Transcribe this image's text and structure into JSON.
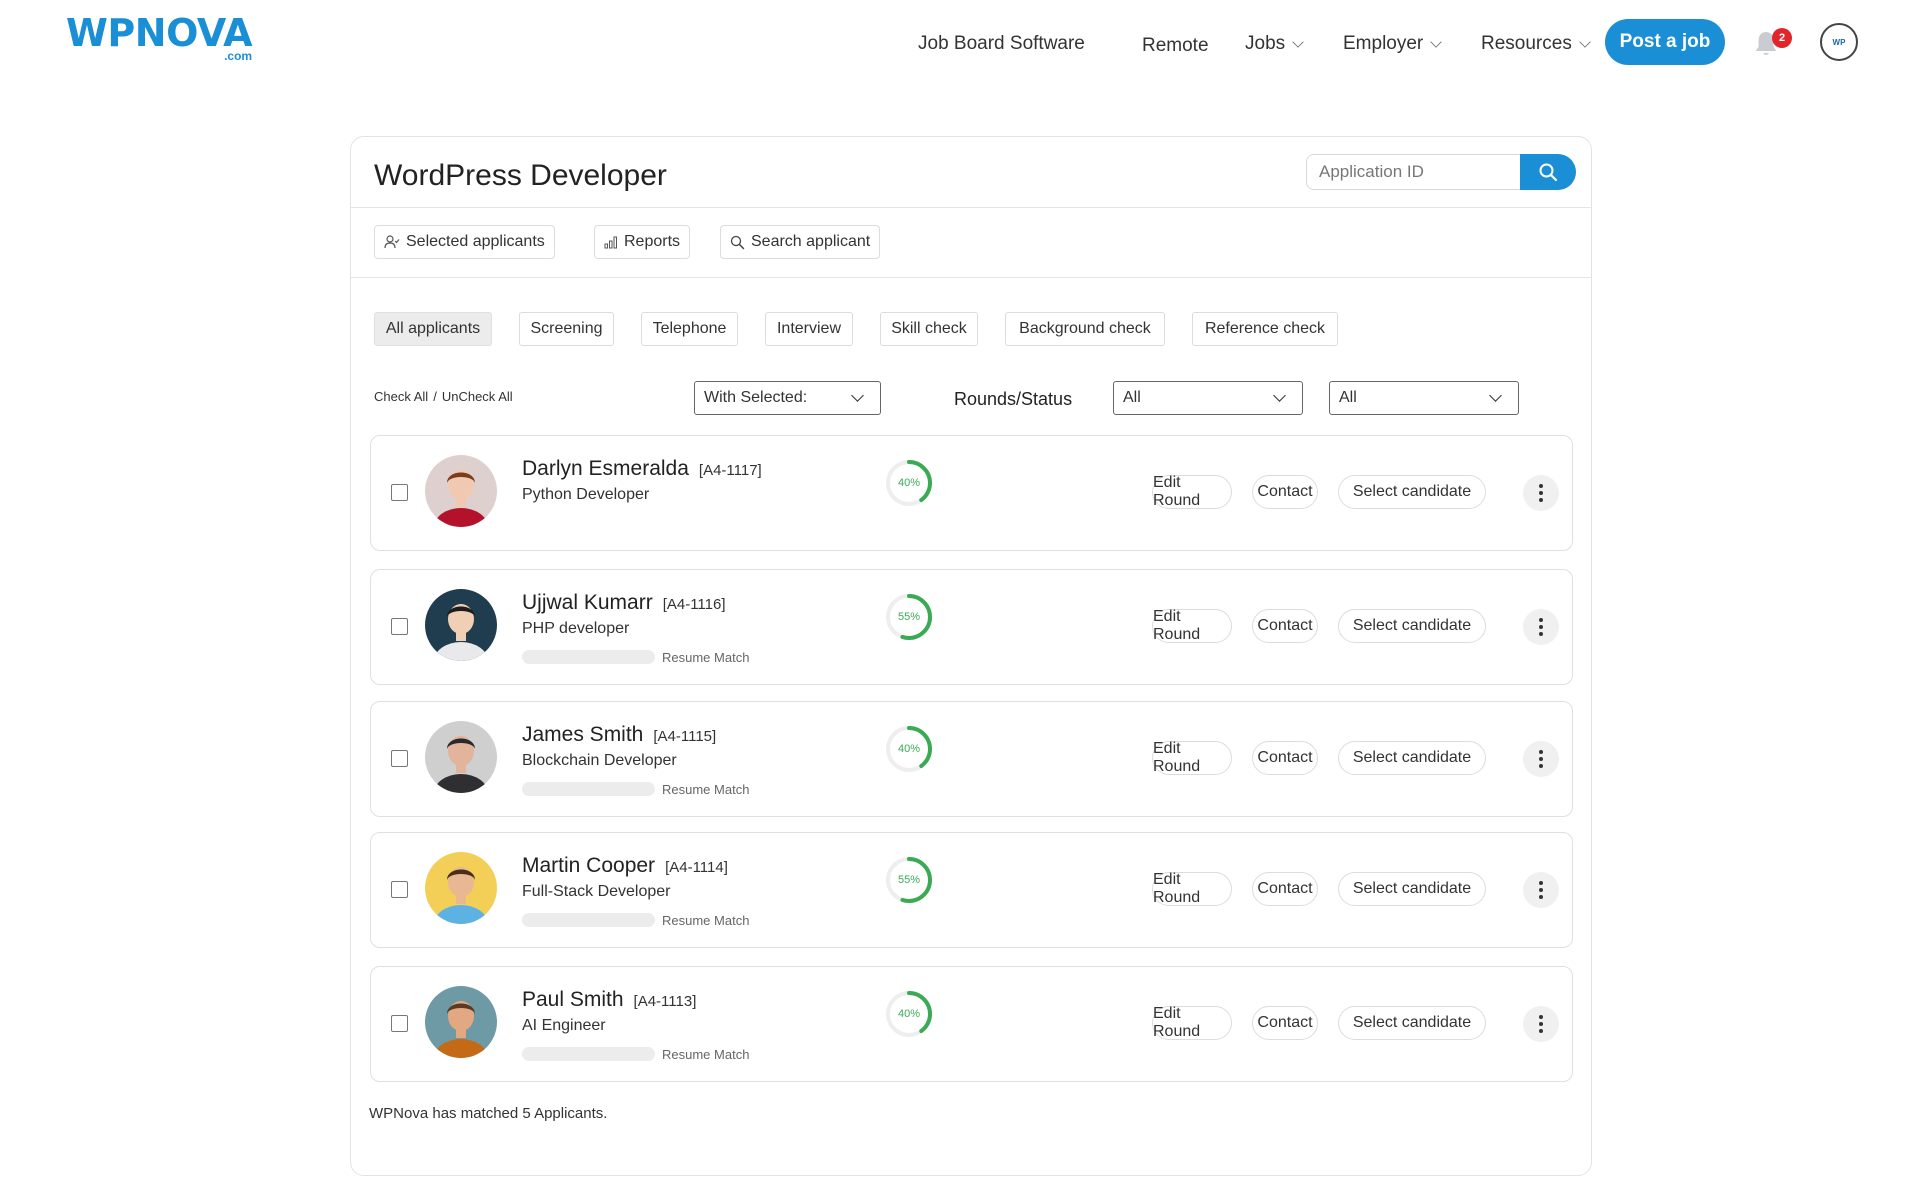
{
  "header": {
    "logo_word": "WPNOVA",
    "logo_tld": ".com",
    "nav": {
      "job_board": "Job Board Software",
      "remote": "Remote",
      "jobs": "Jobs",
      "employer": "Employer",
      "resources": "Resources"
    },
    "post_job": "Post a job",
    "notification_count": "2",
    "user_avatar_text": "WP"
  },
  "page": {
    "title": "WordPress Developer",
    "search_placeholder": "Application ID",
    "toolbar": {
      "selected": "Selected applicants",
      "reports": "Reports",
      "search": "Search applicant"
    },
    "tabs": [
      "All applicants",
      "Screening",
      "Telephone",
      "Interview",
      "Skill check",
      "Background check",
      "Reference check"
    ],
    "active_tab": "All applicants",
    "check_all": "Check All",
    "separator": "/",
    "uncheck_all": "UnCheck All",
    "with_selected": "With Selected:",
    "rounds_label": "Rounds/Status",
    "round_filter": "All",
    "status_filter": "All",
    "footer_note": "WPNova has matched 5 Applicants."
  },
  "actions": {
    "edit_round": "Edit Round",
    "contact": "Contact",
    "select_candidate": "Select candidate",
    "resume_match": "Resume Match"
  },
  "applicants": [
    {
      "name": "Darlyn Esmeralda",
      "id": "[A4-1117]",
      "role": "Python Developer",
      "score": "40%",
      "score_value": 40,
      "show_match": false,
      "avatar_bg": "#ddd0cf",
      "avatar_skin": "#f1c9b3",
      "avatar_hair": "#7a3e1e",
      "avatar_shirt": "#b3122a"
    },
    {
      "name": "Ujjwal Kumarr",
      "id": "[A4-1116]",
      "role": "PHP developer",
      "score": "55%",
      "score_value": 55,
      "show_match": true,
      "avatar_bg": "#1f3d4f",
      "avatar_skin": "#f0cfb4",
      "avatar_hair": "#1d1d1d",
      "avatar_shirt": "#e9e9ec"
    },
    {
      "name": "James Smith",
      "id": "[A4-1115]",
      "role": "Blockchain Developer",
      "score": "40%",
      "score_value": 40,
      "show_match": true,
      "avatar_bg": "#cfcfcf",
      "avatar_skin": "#e2b49b",
      "avatar_hair": "#2a2a2a",
      "avatar_shirt": "#2f2f33"
    },
    {
      "name": "Martin Cooper",
      "id": "[A4-1114]",
      "role": "Full-Stack Developer",
      "score": "55%",
      "score_value": 55,
      "show_match": true,
      "avatar_bg": "#f4cf57",
      "avatar_skin": "#e9b892",
      "avatar_hair": "#4a2e18",
      "avatar_shirt": "#5bb2e3"
    },
    {
      "name": "Paul Smith",
      "id": "[A4-1113]",
      "role": "AI Engineer",
      "score": "40%",
      "score_value": 40,
      "show_match": true,
      "avatar_bg": "#6e9aa6",
      "avatar_skin": "#e2a882",
      "avatar_hair": "#5a3a22",
      "avatar_shirt": "#c46a16"
    }
  ],
  "colors": {
    "brand": "#1a8fd6",
    "ring_green": "#3aaa55",
    "badge_red": "#e0262a"
  },
  "icons": {
    "search": "search-icon",
    "bell": "bell-icon",
    "user": "user-check-icon",
    "reports": "bar-chart-icon",
    "more": "more-vertical-icon"
  }
}
